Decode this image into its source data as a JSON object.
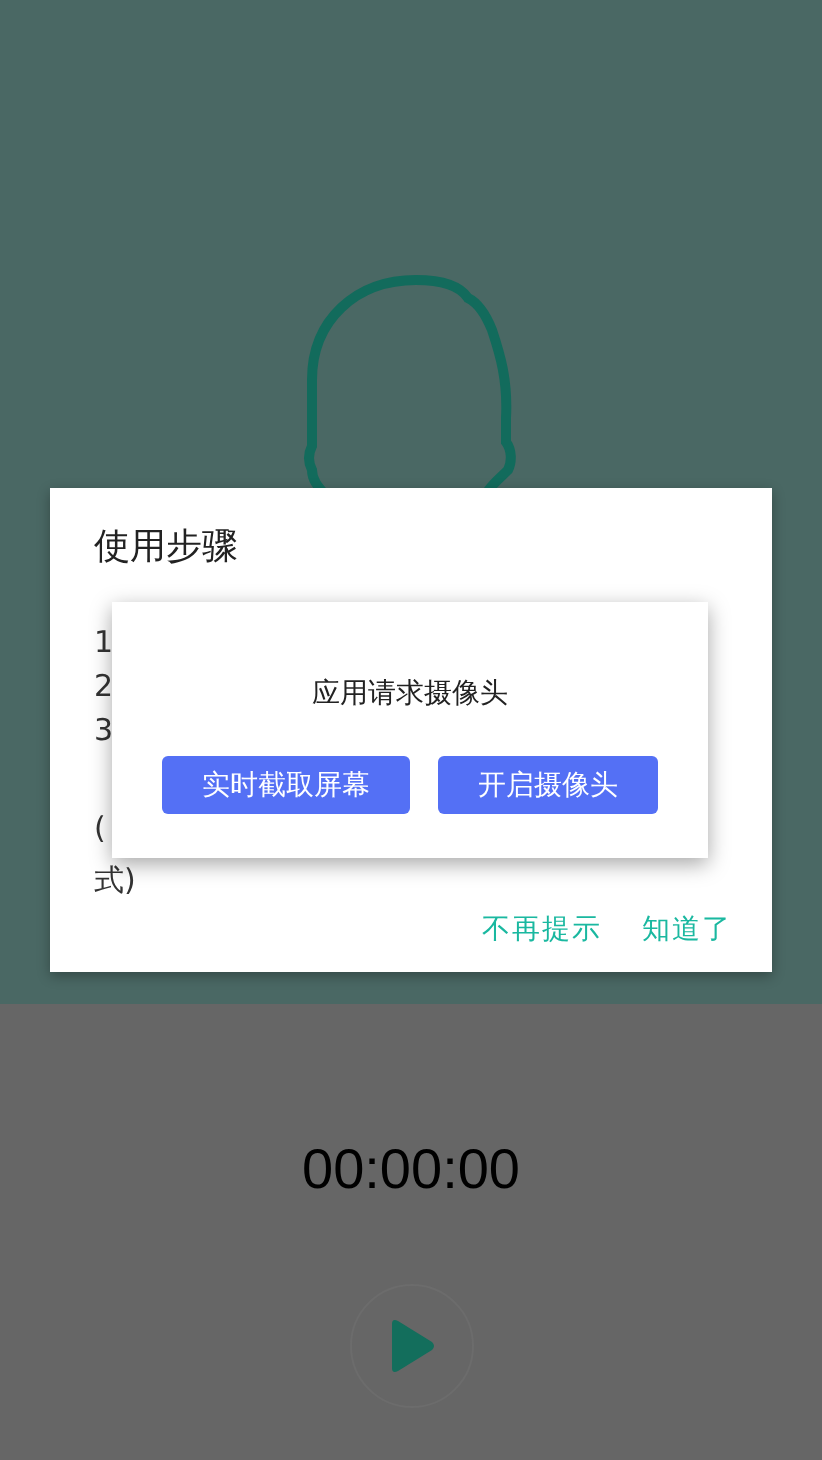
{
  "guide_dialog": {
    "title": "使用步骤",
    "step_lines": [
      "1",
      "2",
      "3"
    ],
    "note_lines": [
      "(",
      "式)"
    ],
    "buttons": [
      "不再提示",
      "知道了"
    ]
  },
  "permission_dialog": {
    "message": "应用请求摄像头",
    "buttons": [
      "实时截取屏幕",
      "开启摄像头"
    ]
  },
  "recorder": {
    "timer": "00:00:00"
  }
}
